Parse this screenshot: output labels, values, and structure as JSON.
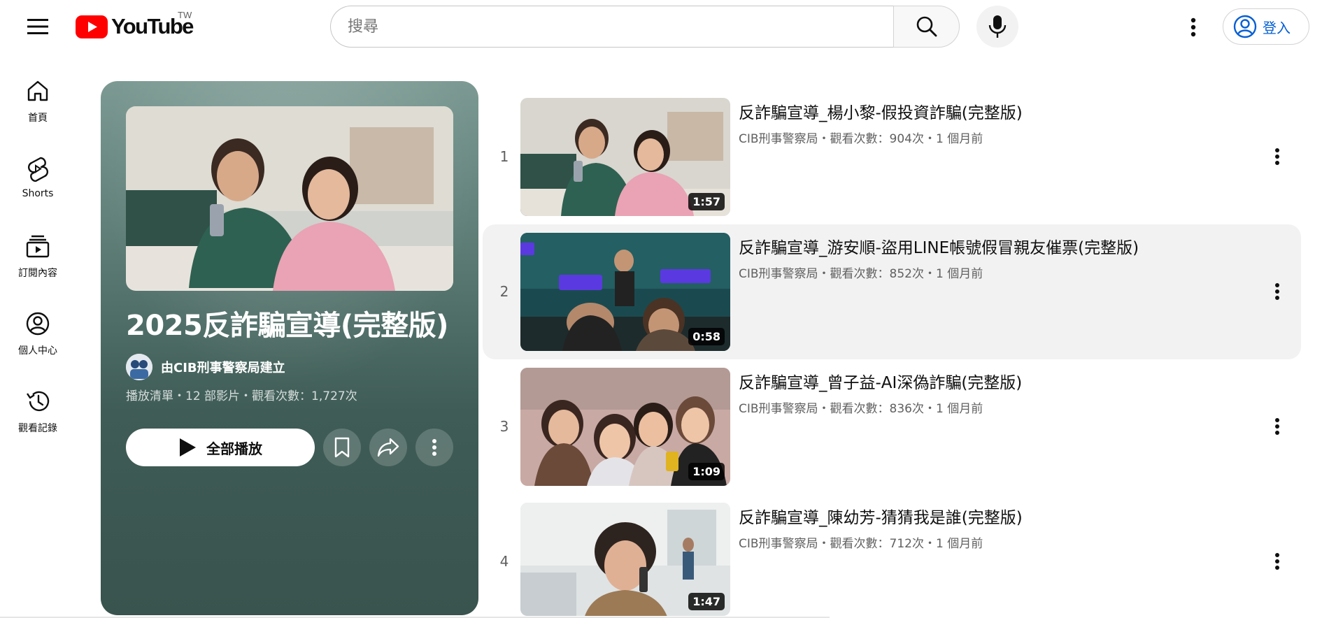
{
  "header": {
    "logo_text": "YouTube",
    "region": "TW",
    "search_placeholder": "搜尋",
    "signin_label": "登入",
    "colors": {
      "logo_red": "#ff0000",
      "signin_blue": "#065fd4"
    }
  },
  "nav": {
    "items": [
      {
        "label": "首頁",
        "icon": "home-icon"
      },
      {
        "label": "Shorts",
        "icon": "shorts-icon"
      },
      {
        "label": "訂閱內容",
        "icon": "subscriptions-icon"
      },
      {
        "label": "個人中心",
        "icon": "account-icon"
      },
      {
        "label": "觀看記錄",
        "icon": "history-icon"
      }
    ]
  },
  "playlist": {
    "title": "2025反詐騙宣導(完整版)",
    "owner": "由CIB刑事警察局建立",
    "meta": "播放清單・12 部影片・觀看次數：1,727次",
    "play_all_label": "全部播放",
    "card_color": "#4a6963"
  },
  "videos": [
    {
      "index": "1",
      "title": "反詐騙宣導_楊小黎-假投資詐騙(完整版)",
      "meta": "CIB刑事警察局・觀看次數：904次・1 個月前",
      "duration": "1:57"
    },
    {
      "index": "2",
      "title": "反詐騙宣導_游安順-盜用LINE帳號假冒親友催票(完整版)",
      "meta": "CIB刑事警察局・觀看次數：852次・1 個月前",
      "duration": "0:58"
    },
    {
      "index": "3",
      "title": "反詐騙宣導_曾子益-AI深偽詐騙(完整版)",
      "meta": "CIB刑事警察局・觀看次數：836次・1 個月前",
      "duration": "1:09"
    },
    {
      "index": "4",
      "title": "反詐騙宣導_陳幼芳-猜猜我是誰(完整版)",
      "meta": "CIB刑事警察局・觀看次數：712次・1 個月前",
      "duration": "1:47"
    }
  ]
}
